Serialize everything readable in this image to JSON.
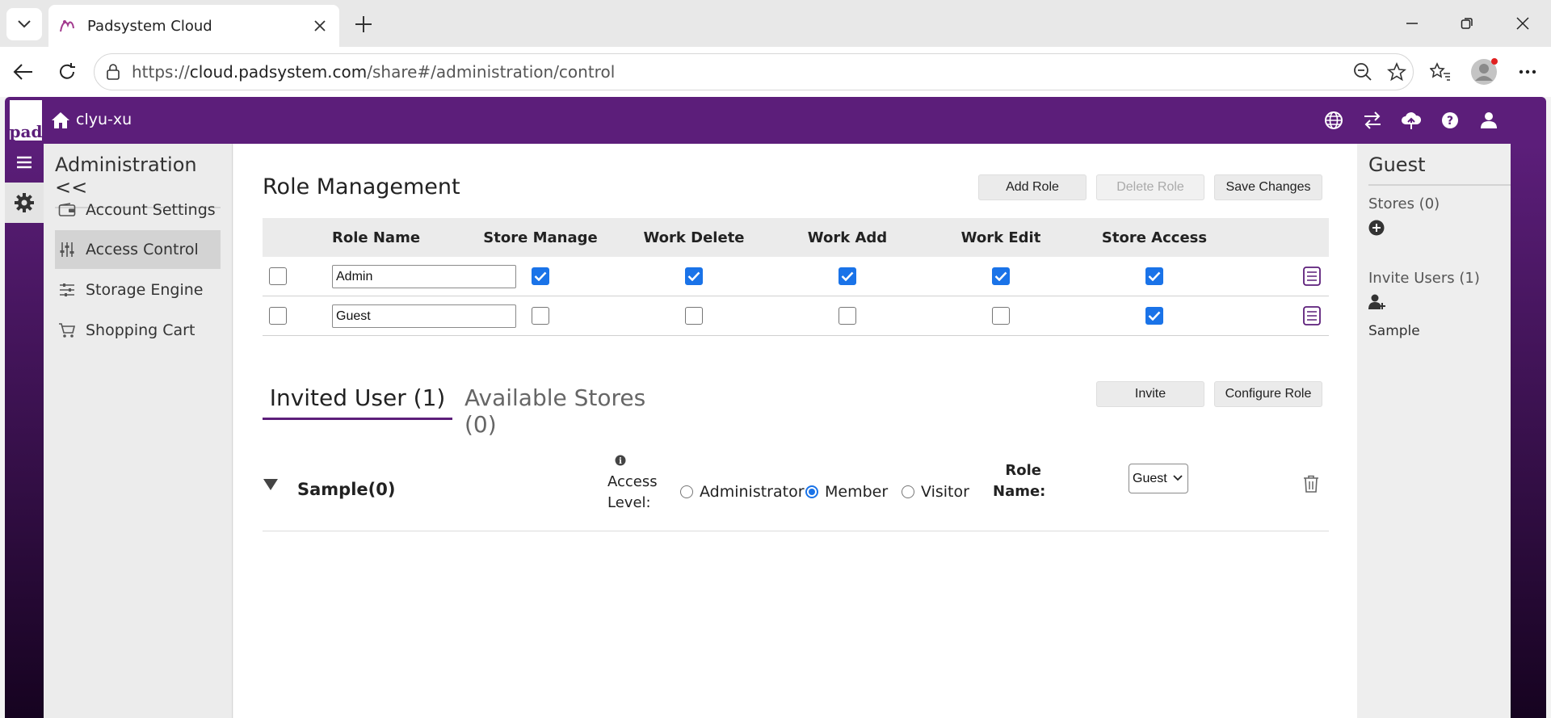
{
  "browser": {
    "tab_title": "Padsystem Cloud",
    "url_prefix": "https://",
    "url_host": "cloud.padsystem.com",
    "url_path": "/share#/administration/control"
  },
  "header": {
    "logo_text": "pad",
    "user": "clyu-xu",
    "icons": [
      "globe-icon",
      "transfer-icon",
      "cloud-upload-icon",
      "help-icon",
      "user-icon"
    ],
    "accent_color": "#5c1e7a"
  },
  "sidebar": {
    "title": "Administration <<",
    "items": [
      {
        "label": "Account Settings",
        "icon": "wallet-icon",
        "active": false
      },
      {
        "label": "Access Control",
        "icon": "sliders-icon",
        "active": true
      },
      {
        "label": "Storage Engine",
        "icon": "sliders-h-icon",
        "active": false
      },
      {
        "label": "Shopping Cart",
        "icon": "cart-icon",
        "active": false
      }
    ]
  },
  "role_management": {
    "title": "Role Management",
    "buttons": {
      "add_role": "Add Role",
      "delete_role": "Delete Role",
      "save_changes": "Save Changes"
    },
    "columns": [
      "Role Name",
      "Store Manage",
      "Work Delete",
      "Work Add",
      "Work Edit",
      "Store Access"
    ],
    "rows": [
      {
        "name": "Admin",
        "selected": false,
        "perms": [
          true,
          true,
          true,
          true,
          true
        ]
      },
      {
        "name": "Guest",
        "selected": false,
        "perms": [
          false,
          false,
          false,
          false,
          true
        ]
      }
    ]
  },
  "tabs": {
    "invited": "Invited User (1)",
    "stores": "Available Stores (0)",
    "invite_button": "Invite",
    "configure_button": "Configure Role"
  },
  "invited_user": {
    "name": "Sample(0)",
    "access_label_1": "Access",
    "access_label_2": "Level:",
    "levels": [
      {
        "label": "Administrator",
        "selected": false
      },
      {
        "label": "Member",
        "selected": true
      },
      {
        "label": "Visitor",
        "selected": false
      }
    ],
    "role_label_1": "Role",
    "role_label_2": "Name:",
    "role_value": "Guest"
  },
  "right_panel": {
    "title": "Guest",
    "stores": "Stores (0)",
    "invite_users": "Invite Users (1)",
    "user": "Sample"
  }
}
